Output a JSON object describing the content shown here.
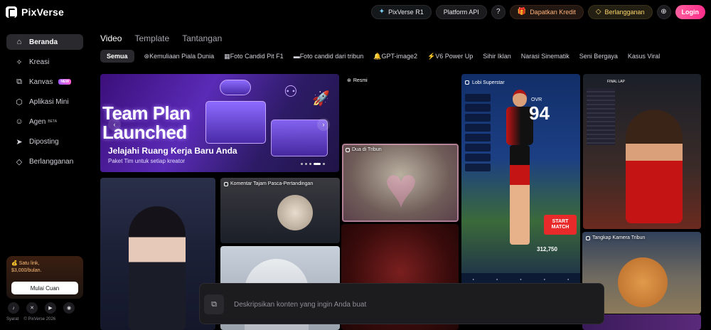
{
  "brand": {
    "name": "PixVerse"
  },
  "header": {
    "r1": "PixVerse R1",
    "api": "Platform API",
    "help_icon": "question-icon",
    "kredit": "Dapatkan Kredit",
    "langganan": "Berlangganan",
    "globe_icon": "globe-icon",
    "login": "Login"
  },
  "sidebar": {
    "items": [
      {
        "label": "Beranda",
        "icon": "home-icon"
      },
      {
        "label": "Kreasi",
        "icon": "sparkle-icon"
      },
      {
        "label": "Kanvas",
        "icon": "canvas-icon",
        "badge": "NEW"
      },
      {
        "label": "Aplikasi Mini",
        "icon": "cube-icon"
      },
      {
        "label": "Agen",
        "icon": "agent-icon",
        "badge": "BETA"
      },
      {
        "label": "Diposting",
        "icon": "send-icon"
      },
      {
        "label": "Berlangganan",
        "icon": "diamond-icon"
      }
    ],
    "promo": {
      "line1": "Satu link,",
      "line2": "$3,000/bulan.",
      "button": "Mulai Cuan"
    },
    "socials": [
      "tiktok-icon",
      "x-icon",
      "youtube-icon",
      "discord-icon"
    ],
    "footer": {
      "terms": "Syarat",
      "copyright": "© PixVerse 2026"
    }
  },
  "tabs": [
    "Video",
    "Template",
    "Tantangan"
  ],
  "chips": [
    "Semua",
    "Kemuliaan Piala Dunia",
    "Foto Candid Pit F1",
    "Foto candid dari tribun",
    "GPT-image2",
    "V6 Power Up",
    "Sihir Iklan",
    "Narasi Sinematik",
    "Seni Bergaya",
    "Kasus Viral"
  ],
  "banner": {
    "title_line1": "Team Plan",
    "title_line2": "Launched",
    "subtitle": "Jelajahi Ruang Kerja Baru Anda",
    "caption": "Paket Tim untuk setiap kreator"
  },
  "tiles": {
    "resmi": "Resmi",
    "heart": "Dua di Tribun",
    "game": "Lobi Superstar",
    "comment": "Komentar Tajam Pasca-Pertandingan",
    "cat": "Tangkap Kamera Tribun",
    "game_ovr": "OVR",
    "game_rating": "94",
    "game_start": "START MATCH",
    "game_price": "312,750",
    "f1_label": "FINAL LAP"
  },
  "prompt": {
    "placeholder": "Deskripsikan konten yang ingin Anda buat"
  }
}
